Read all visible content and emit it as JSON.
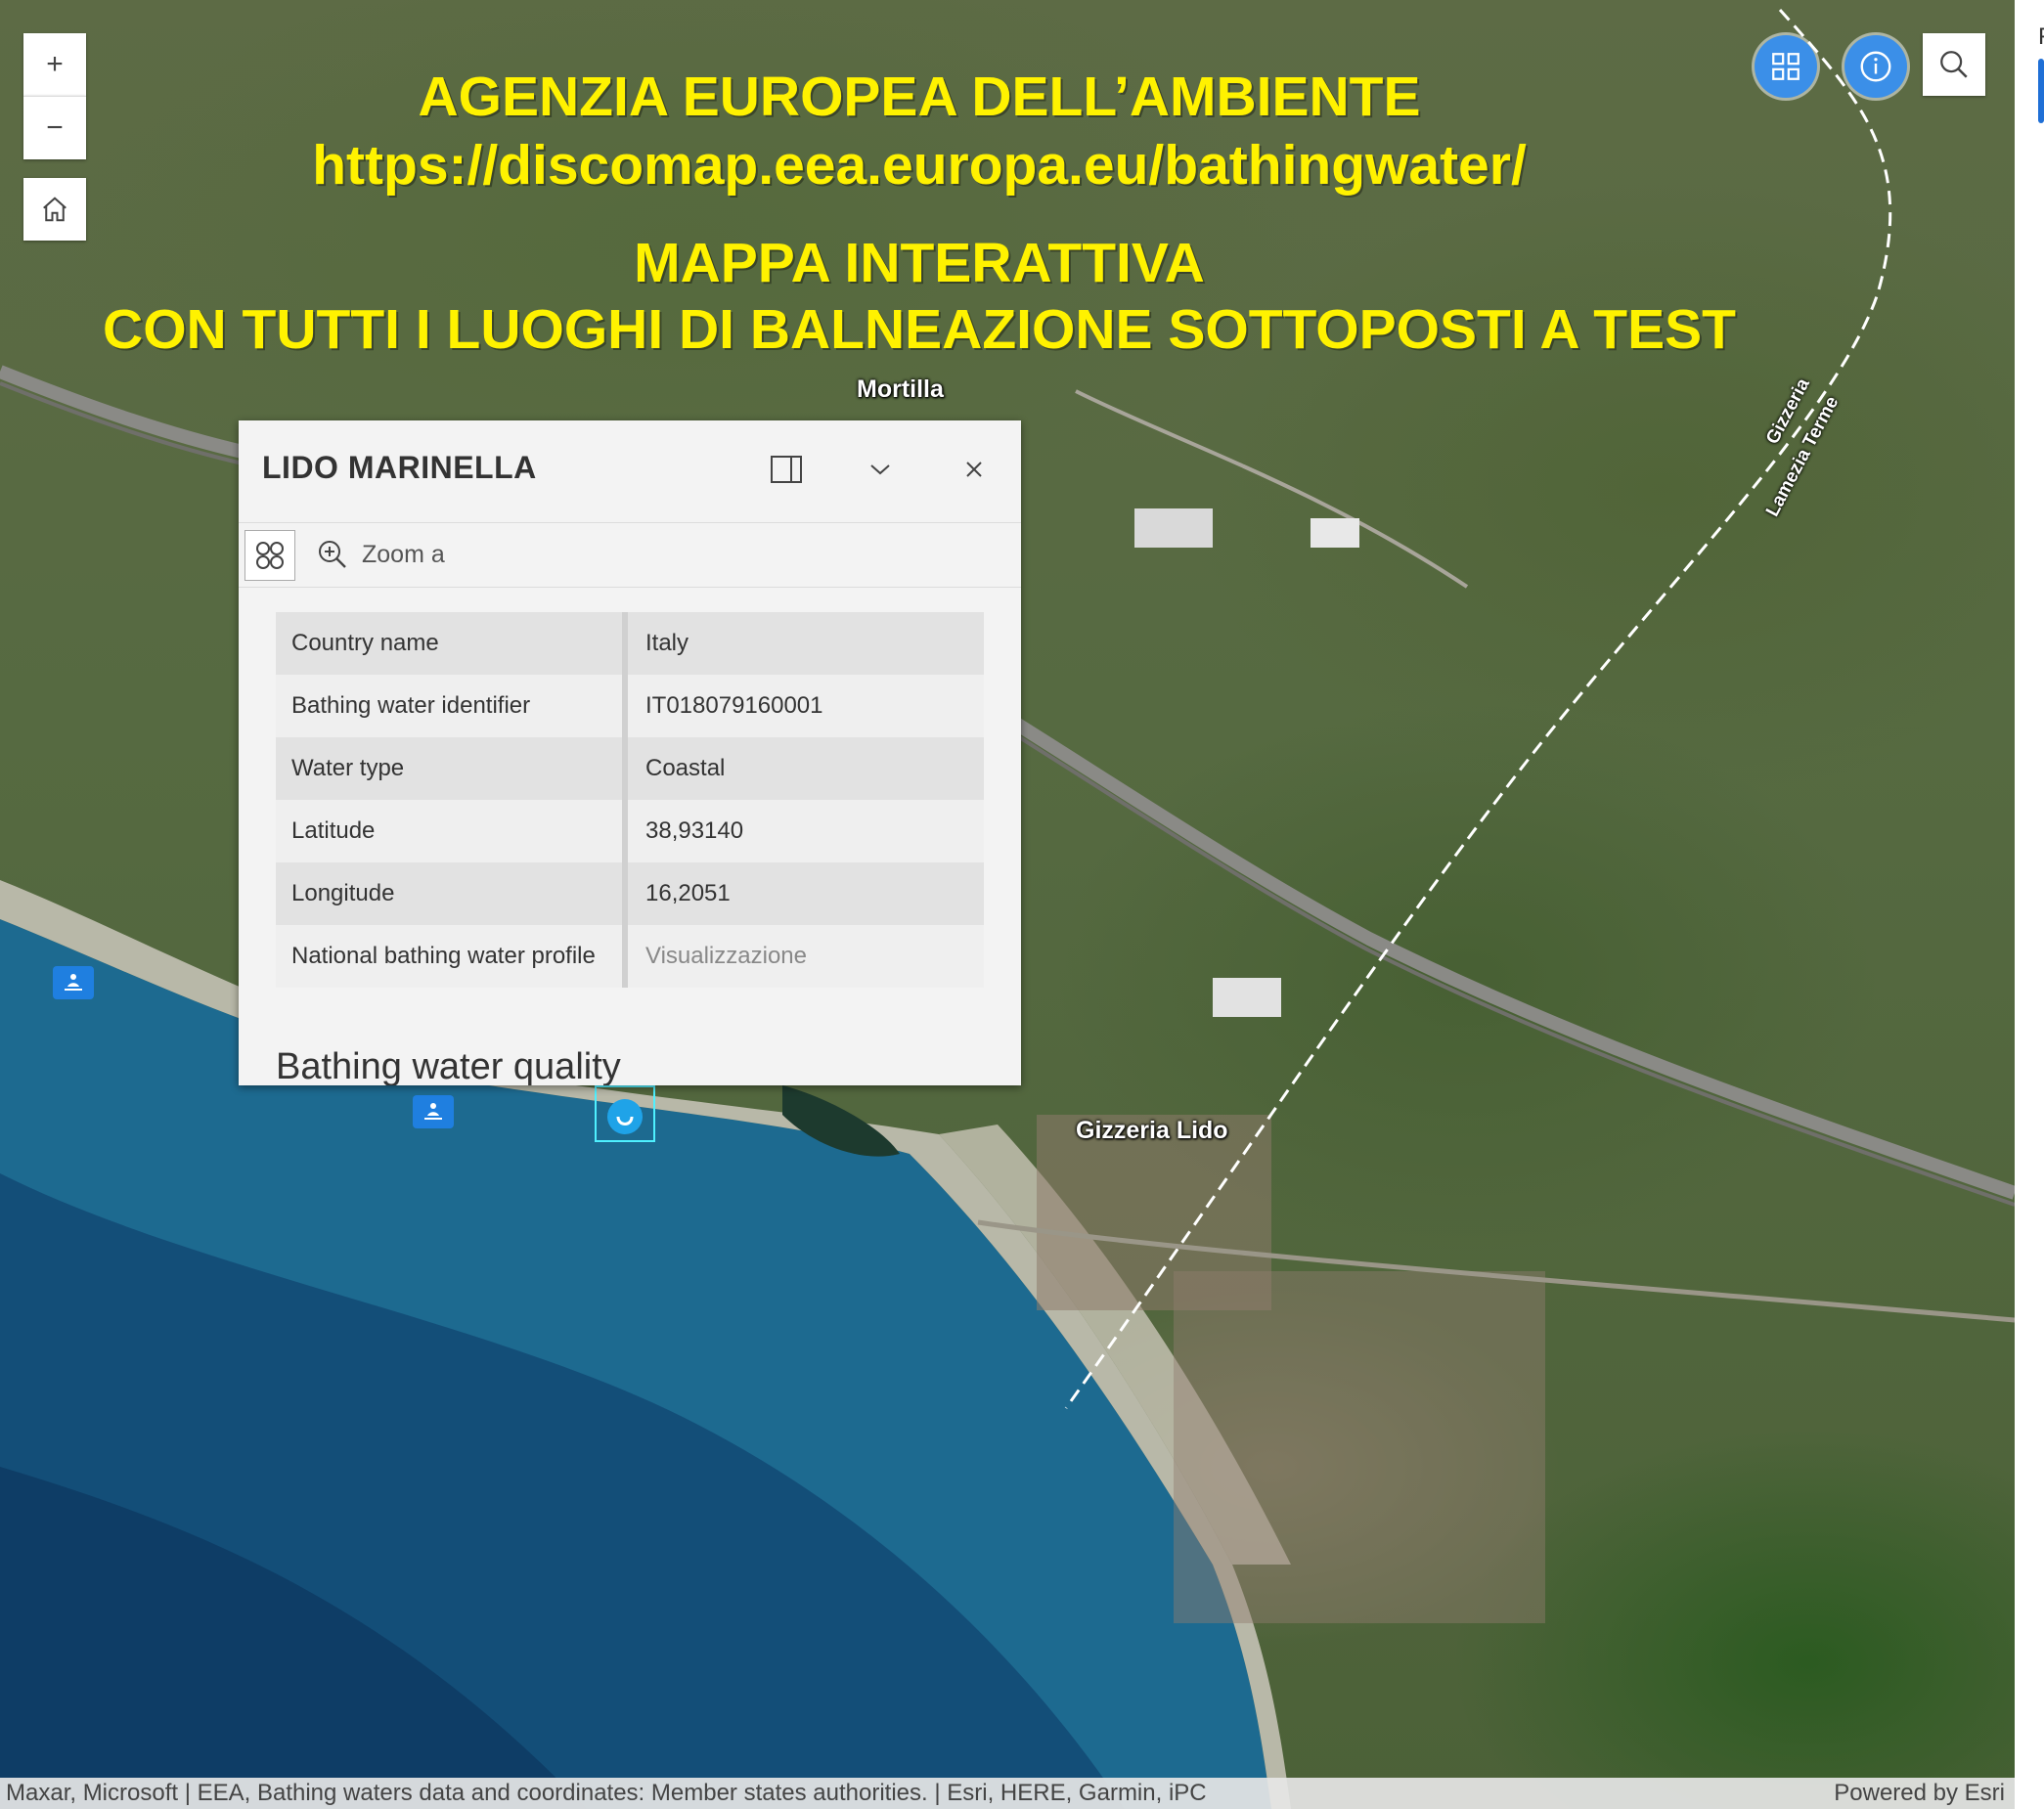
{
  "overlay": {
    "line1": "AGENZIA EUROPEA DELL’AMBIENTE",
    "line2": "https://discomap.eea.europa.eu/bathingwater/",
    "line3": "MAPPA INTERATTIVA",
    "line4": "CON TUTTI I LUOGHI DI BALNEAZIONE SOTTOPOSTI A TEST"
  },
  "map_labels": {
    "mortilla": "Mortilla",
    "gizzeria_lido": "Gizzeria Lido",
    "road1": "Gizzeria",
    "road2": "Lamezia Terme"
  },
  "controls": {
    "zoom_in": "+",
    "zoom_out": "−"
  },
  "popup": {
    "title": "LIDO MARINELLA",
    "zoom_label": "Zoom a",
    "rows": [
      {
        "key": "Country name",
        "value": "Italy"
      },
      {
        "key": "Bathing water identifier",
        "value": "IT018079160001"
      },
      {
        "key": "Water type",
        "value": "Coastal"
      },
      {
        "key": "Latitude",
        "value": "38,93140"
      },
      {
        "key": "Longitude",
        "value": "16,2051"
      },
      {
        "key": "National bathing water profile",
        "value": "Visualizzazione"
      }
    ],
    "section": "Bathing water quality"
  },
  "attribution": {
    "left": "Maxar, Microsoft | EEA, Bathing waters data and coordinates: Member states authorities. | Esri, HERE, Garmin, iPC",
    "right": "Powered by Esri"
  },
  "edge_char": "F",
  "colors": {
    "overlay_text": "#fff200",
    "accent": "#3b8fe8",
    "marker": "#1f7fe0",
    "highlight": "#4ff0ff"
  }
}
